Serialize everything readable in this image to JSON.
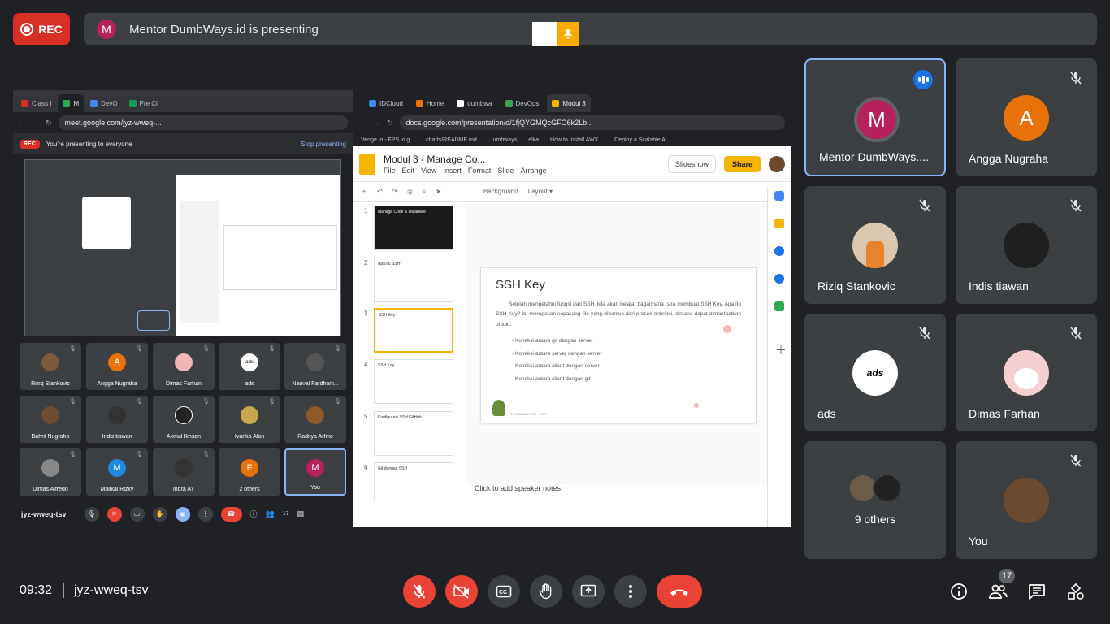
{
  "recording": {
    "label": "REC"
  },
  "presenting": {
    "initial": "M",
    "text": "Mentor DumbWays.id is presenting"
  },
  "shared_screen": {
    "left_window": {
      "tabs": [
        "Class I",
        "M",
        "DevO",
        "Pre Cl"
      ],
      "url": "meet.google.com/jyz-wweq-...",
      "presenting_label": "You're presenting to everyone",
      "stop_label": "Stop presenting",
      "rec_label": "REC",
      "tiles": [
        {
          "name": "Riziq Stankovic",
          "initial": "",
          "color": "#7a5a3a"
        },
        {
          "name": "Angga Nugraha",
          "initial": "A",
          "color": "#e8710a"
        },
        {
          "name": "Dimas Farhan",
          "initial": "",
          "color": "#f1b7b7"
        },
        {
          "name": "ads",
          "initial": "ads",
          "color": "#ffffff"
        },
        {
          "name": "Nauval Fardhani...",
          "initial": "",
          "color": "#555"
        },
        {
          "name": "Bahril Nugroho",
          "initial": "",
          "color": "#6d4c33"
        },
        {
          "name": "Indis tiawan",
          "initial": "",
          "color": "#333"
        },
        {
          "name": "Akmal Ikhsan",
          "initial": "",
          "color": "#222"
        },
        {
          "name": "Ivanka Alan",
          "initial": "",
          "color": "#c8a64a"
        },
        {
          "name": "Raditya Arfino",
          "initial": "",
          "color": "#8d5a2b"
        },
        {
          "name": "Dimas Alfredo",
          "initial": "",
          "color": "#888"
        },
        {
          "name": "Malikal Rizky",
          "initial": "M",
          "color": "#1e88e5"
        },
        {
          "name": "Indra AY",
          "initial": "",
          "color": "#333"
        },
        {
          "name": "2 others",
          "initial": "F",
          "color": "#e8710a"
        },
        {
          "name": "You",
          "initial": "M",
          "color": "#b5205d"
        }
      ],
      "meeting_code": "jyz-wweq-tsv",
      "people_count": "17"
    },
    "right_window": {
      "tabs": [
        "IDCloud",
        "Home",
        "dumbwa",
        "DevOps",
        "Modul 3"
      ],
      "url": "docs.google.com/presentation/d/1fjQYGMQcGFO6k2Lb...",
      "bookmarks": [
        "Venge.io - FPS io g...",
        "charts/README.md...",
        "umbways",
        "elka",
        "How to Install AWX...",
        "Deploy a Scalable A..."
      ],
      "doc_title": "Modul 3 - Manage Co...",
      "menu": [
        "File",
        "Edit",
        "View",
        "Insert",
        "Format",
        "Slide",
        "Arrange"
      ],
      "slideshow_label": "Slideshow",
      "share_label": "Share",
      "toolbar_items": [
        "Background",
        "Layout ▾"
      ],
      "thumb_titles": [
        "Manage Code & Database",
        "Apa itu SSH?",
        "SSH Key",
        "SSH Key",
        "Konfigurasi SSH GitHub",
        "Git dengan SSH"
      ],
      "slide": {
        "title": "SSH Key",
        "body": "Setelah mengetahui fungsi dari SSH, kita akan belajar bagaimana cara membuat SSH Key. Apa itu SSH Key? itu merupakan sepasang file yang dibentuk dari proses enkripsi, dimana dapat dimanfaatkan untuk :",
        "items": [
          "Koneksi antara git dengan server",
          "Koneksi antara server dengan server",
          "Koneksi antara client dengan server",
          "Koneksi antara client dengan git"
        ],
        "footer": "© DUMBWAYS.ID - 2021"
      },
      "speaker_notes": "Click to add speaker notes"
    }
  },
  "participants": [
    {
      "name": "Mentor DumbWays....",
      "initial": "M",
      "color": "#b5205d",
      "speaking": true
    },
    {
      "name": "Angga Nugraha",
      "initial": "A",
      "color": "#e8710a",
      "speaking": false
    },
    {
      "name": "Riziq Stankovic",
      "initial": "",
      "color": "#8a6a4a",
      "speaking": false
    },
    {
      "name": "Indis tiawan",
      "initial": "",
      "color": "#1f1f1f",
      "speaking": false
    },
    {
      "name": "ads",
      "initial": "ads",
      "color": "#ffffff",
      "speaking": false
    },
    {
      "name": "Dimas Farhan",
      "initial": "",
      "color": "#f6d0d0",
      "speaking": false
    },
    {
      "name": "9 others",
      "initial": "",
      "color": "#3c4043",
      "speaking": false
    },
    {
      "name": "You",
      "initial": "",
      "color": "#6b4a30",
      "speaking": false
    }
  ],
  "bottom_bar": {
    "time": "09:32",
    "meeting_code": "jyz-wweq-tsv",
    "people_count": "17"
  },
  "colors": {
    "red": "#ea4335",
    "accent": "#8ab4f8",
    "tile": "#3c4043",
    "background": "#202124"
  }
}
